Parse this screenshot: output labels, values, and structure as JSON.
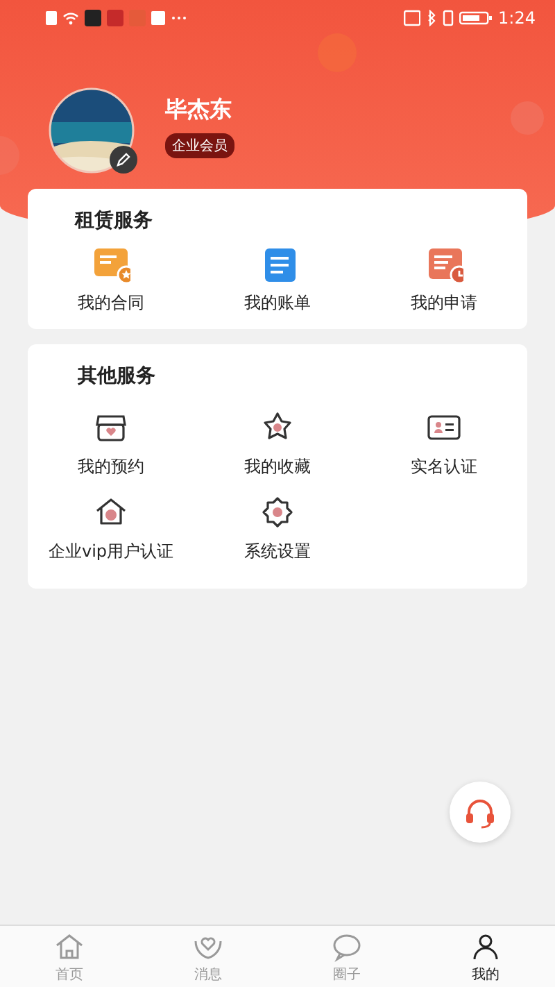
{
  "status_bar": {
    "time": "1:24"
  },
  "profile": {
    "name": "毕杰东",
    "badge": "企业会员"
  },
  "sections": [
    {
      "title": "租赁服务",
      "kind": "color",
      "items": [
        {
          "label": "我的合同"
        },
        {
          "label": "我的账单"
        },
        {
          "label": "我的申请"
        }
      ]
    },
    {
      "title": "其他服务",
      "kind": "line",
      "items": [
        {
          "label": "我的预约"
        },
        {
          "label": "我的收藏"
        },
        {
          "label": "实名认证"
        },
        {
          "label": "企业vip用户认证"
        },
        {
          "label": "系统设置"
        }
      ]
    }
  ],
  "tabs": [
    {
      "label": "首页",
      "selected": false
    },
    {
      "label": "消息",
      "selected": false
    },
    {
      "label": "圈子",
      "selected": false
    },
    {
      "label": "我的",
      "selected": true
    }
  ]
}
